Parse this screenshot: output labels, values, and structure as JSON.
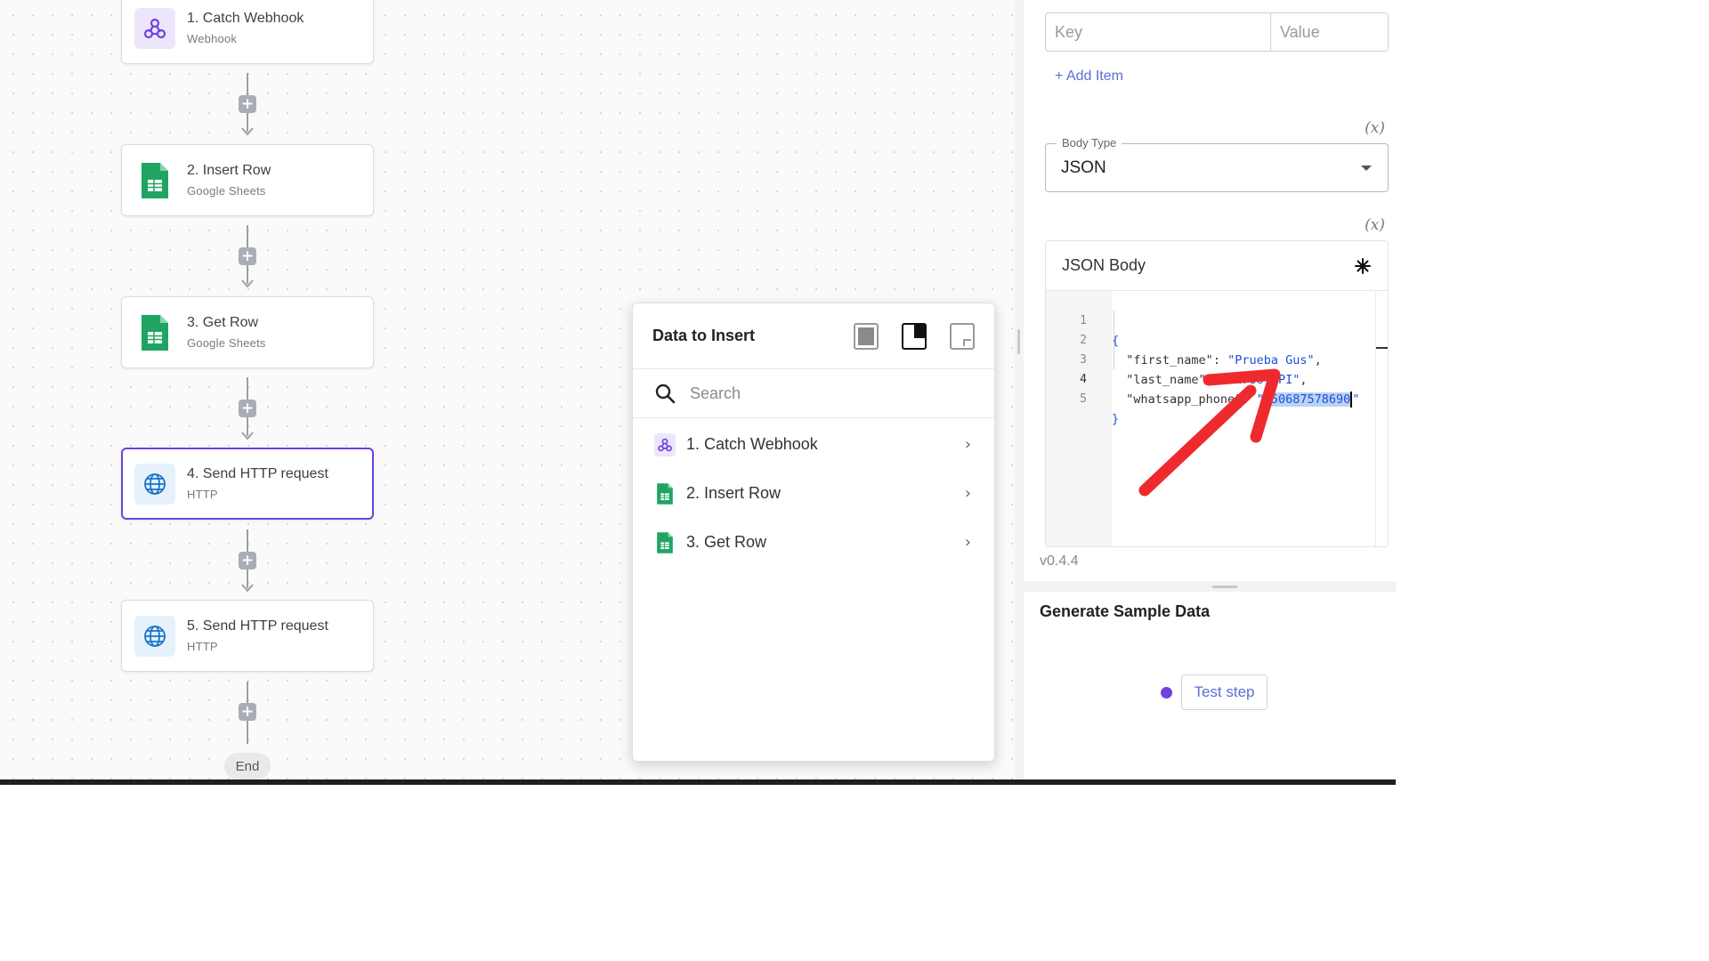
{
  "flow": {
    "steps": [
      {
        "title": "1. Catch Webhook",
        "subtitle": "Webhook",
        "icon": "webhook-icon"
      },
      {
        "title": "2. Insert Row",
        "subtitle": "Google Sheets",
        "icon": "google-sheets-icon"
      },
      {
        "title": "3. Get Row",
        "subtitle": "Google Sheets",
        "icon": "google-sheets-icon"
      },
      {
        "title": "4. Send HTTP request",
        "subtitle": "HTTP",
        "icon": "globe-icon",
        "selected": true
      },
      {
        "title": "5. Send HTTP request",
        "subtitle": "HTTP",
        "icon": "globe-icon"
      }
    ],
    "end_label": "End",
    "add_symbol": "+"
  },
  "data_popup": {
    "title": "Data to Insert",
    "search_placeholder": "Search",
    "items": [
      {
        "label": "1. Catch Webhook",
        "icon": "webhook-icon"
      },
      {
        "label": "2. Insert Row",
        "icon": "google-sheets-icon"
      },
      {
        "label": "3. Get Row",
        "icon": "google-sheets-icon"
      }
    ],
    "chevron": "›"
  },
  "right_panel": {
    "key_placeholder": "Key",
    "value_placeholder": "Value",
    "add_item_label": "+ Add Item",
    "fx_label": "(x)",
    "body_type": {
      "label": "Body Type",
      "value": "JSON"
    },
    "json_body": {
      "title": "JSON Body",
      "line_numbers": [
        "1",
        "2",
        "3",
        "4",
        "5"
      ],
      "open_brace": "{",
      "close_brace": "}",
      "fields": [
        {
          "key": "\"first_name\"",
          "value": "\"Prueba Gus\""
        },
        {
          "key": "\"last_name\"",
          "value": "\"Curso API\""
        },
        {
          "key": "\"whatsapp_phone\"",
          "value_selected": "+50687578690"
        }
      ]
    },
    "version": "v0.4.4",
    "generate_title": "Generate Sample Data",
    "test_button": "Test step"
  },
  "colors": {
    "accent": "#6e41e2",
    "annotation_arrow": "#ee2a2f",
    "sheets_green": "#1fa463",
    "link_blue": "#5a6fd6"
  }
}
